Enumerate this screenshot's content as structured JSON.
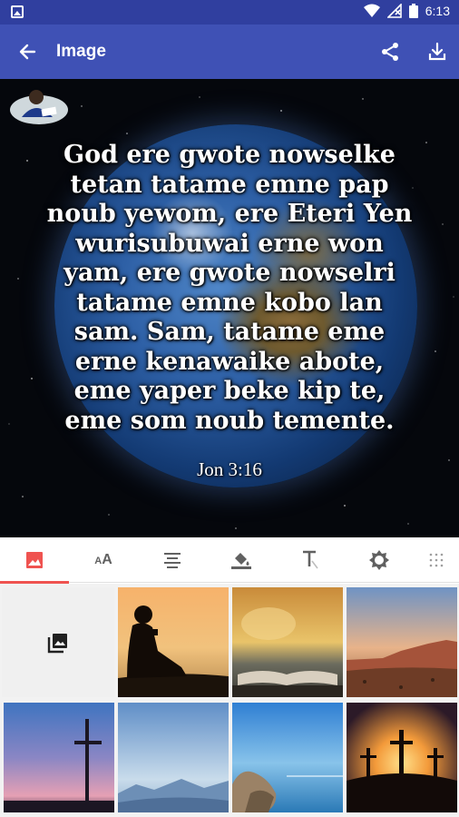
{
  "status_bar": {
    "time": "6:13",
    "icons": [
      "image-notification-icon",
      "wifi-icon",
      "no-signal-icon",
      "battery-icon"
    ]
  },
  "app_bar": {
    "title": "Image",
    "back_icon": "arrow-back-icon",
    "share_icon": "share-icon",
    "download_icon": "download-icon"
  },
  "quote": {
    "text": "God ere gwote nowselke\ntetan tatame emne pap\nnoub yewom, ere Eteri Yen\nwurisubuwai erne won\nyam, ere gwote nowselri\ntatame emne kobo lan\nsam. Sam, tatame eme\nerne kenawaike abote,\neme yaper beke kip te,\neme som noub temente.",
    "reference": "Jon 3:16"
  },
  "toolbar": {
    "tools": [
      {
        "name": "background-image",
        "icon": "image-icon",
        "active": true
      },
      {
        "name": "font-size",
        "icon": "text-size-icon",
        "label_small": "A",
        "label_big": "A",
        "active": false
      },
      {
        "name": "alignment",
        "icon": "align-icon",
        "active": false
      },
      {
        "name": "color",
        "icon": "paint-bucket-icon",
        "active": false
      },
      {
        "name": "font-style",
        "icon": "text-format-icon",
        "active": false
      },
      {
        "name": "brightness",
        "icon": "brightness-icon",
        "active": false
      },
      {
        "name": "texture",
        "icon": "grid-dots-icon",
        "active": false
      }
    ],
    "accent_color": "#ef5350"
  },
  "backgrounds": {
    "picker_icon": "photo-library-icon",
    "tiles": [
      {
        "name": "boy-reading-sunset",
        "theme": "silhouette reading at sunset"
      },
      {
        "name": "open-book-sunset",
        "theme": "open bible at sunset"
      },
      {
        "name": "desert-mountains",
        "theme": "desert mesa dusk"
      },
      {
        "name": "cross-twilight",
        "theme": "cross at twilight"
      },
      {
        "name": "misty-mountains",
        "theme": "blue misty mountains"
      },
      {
        "name": "rocky-sea",
        "theme": "rocks by calm sea"
      },
      {
        "name": "three-crosses",
        "theme": "three crosses at sunrise"
      }
    ]
  },
  "colors": {
    "status_bar": "#303f9f",
    "app_bar": "#3f51b5",
    "accent": "#ef5350"
  }
}
